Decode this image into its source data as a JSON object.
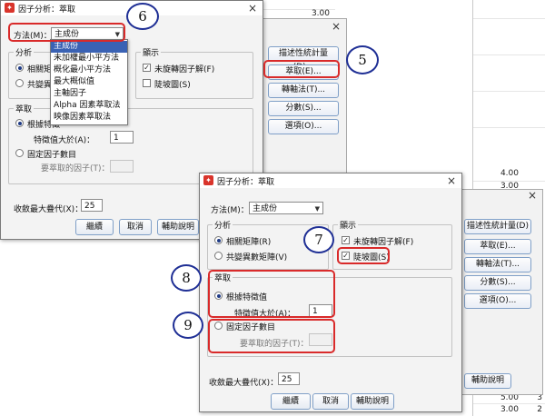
{
  "spreadsheet_values": {
    "a": "3.00",
    "b": "4.00",
    "c": "3.00",
    "d": "5.00",
    "e": "3.00"
  },
  "trailing_values": {
    "t1": "3",
    "t2": "2"
  },
  "side_buttons_back": [
    "描述性統計量(D)...",
    "萃取(E)...",
    "轉軸法(T)...",
    "分數(S)...",
    "選項(O)..."
  ],
  "side_buttons_front": [
    "描述性統計量(D)",
    "萃取(E)...",
    "轉軸法(T)...",
    "分數(S)...",
    "選項(O)..."
  ],
  "behind_help": "輔助說明",
  "dialog1": {
    "title": "因子分析：萃取",
    "method_label": "方法(M)：",
    "method_value": "主成份",
    "analysis_title": "分析",
    "analysis_opt1": "相關矩陣",
    "analysis_opt2": "共變異數",
    "display_title": "顯示",
    "display_opt1": "未旋轉因子解(F)",
    "display_opt2": "陡坡圖(S)",
    "extract_title": "萃取",
    "based_eigen": "根據特徵",
    "eigen_label": "特徵值大於(A)：",
    "eigen_value": "1",
    "fixed_label": "固定因子數目",
    "factors_label": "要萃取的因子(T)：",
    "maxiter_label": "收斂最大疊代(X)：",
    "maxiter_value": "25",
    "btn_continue": "繼續",
    "btn_cancel": "取消",
    "btn_help": "輔助說明",
    "dropdown_options": [
      "主成份",
      "未加權最小平方法",
      "概化最小平方法",
      "最大概似值",
      "主軸因子",
      "Alpha 因素萃取法",
      "映像因素萃取法"
    ]
  },
  "dialog2": {
    "title": "因子分析：萃取",
    "method_label": "方法(M)：",
    "method_value": "主成份",
    "analysis_title": "分析",
    "analysis_opt1": "相關矩陣(R)",
    "analysis_opt2": "共變異數矩陣(V)",
    "display_title": "顯示",
    "display_opt1": "未旋轉因子解(F)",
    "display_opt2": "陡坡圖(S)",
    "extract_title": "萃取",
    "based_eigen": "根據特徵值",
    "eigen_label": "特徵值大於(A)：",
    "eigen_value": "1",
    "fixed_label": "固定因子數目",
    "factors_label": "要萃取的因子(T)：",
    "maxiter_label": "收斂最大疊代(X)：",
    "maxiter_value": "25",
    "btn_continue": "繼續",
    "btn_cancel": "取消",
    "btn_help": "輔助說明"
  },
  "markers": [
    "6",
    "5",
    "7",
    "8",
    "9"
  ],
  "colors": {
    "highlight": "#d92a2a",
    "marker_border": "#1f2f95",
    "selection": "#3a62b4"
  }
}
